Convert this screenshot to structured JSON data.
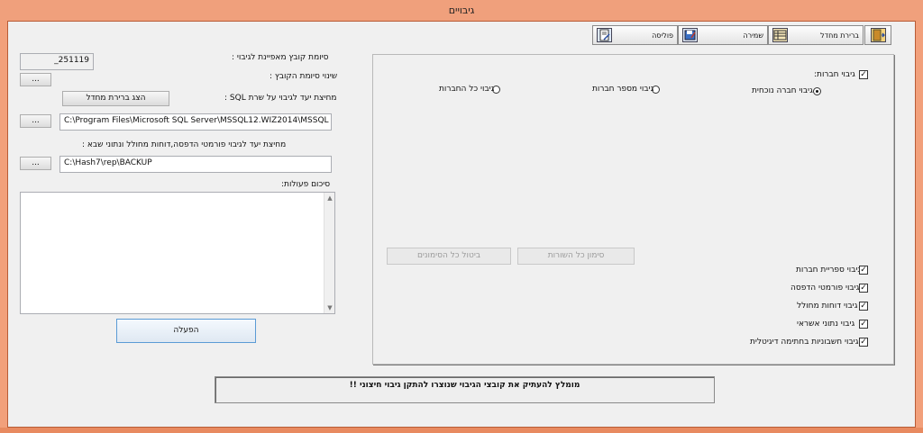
{
  "window": {
    "title": "גיבויים"
  },
  "toolbar": {
    "policy_label": "פוליסה",
    "save_label": "שמירה",
    "default_label": "ברירת מחדל"
  },
  "left": {
    "file_suffix_label": "סיומת קובץ מאפיינת לגיבוי :",
    "file_suffix_value": "_251119",
    "change_suffix_label": "שינוי סיומת הקובץ :",
    "browse_label": "...",
    "sql_path_label": "מחיצת יעד לגיבוי על שרת SQL :",
    "show_default_button": "הצג ברירת מחדל",
    "sql_path_value": "C:\\Program Files\\Microsoft SQL Server\\MSSQL12.WIZ2014\\MSSQL",
    "forms_path_label": "מחיצת יעד לגיבוי פורמטי הדפסה,דוחות מחולל ונתוני שבא :",
    "forms_path_value": "C:\\Hash7\\rep\\BACKUP",
    "summary_label": "סיכום פעולות:",
    "summary_text": "",
    "run_button": "הפעלה"
  },
  "right": {
    "companies_backup": {
      "label": "גיבוי חברות:",
      "checked": true
    },
    "radios": [
      {
        "label": "גיבוי חברה נוכחית",
        "selected": true
      },
      {
        "label": "גיבוי מספר חברות",
        "selected": false
      },
      {
        "label": "גיבוי כל החברות",
        "selected": false
      }
    ],
    "mark_all_button": "סימון כל השורות",
    "clear_all_button": "ביטול כל הסימונים",
    "options": [
      {
        "label": "גיבוי ספריית חברות",
        "checked": true
      },
      {
        "label": "גיבוי פורמטי הדפסה",
        "checked": true
      },
      {
        "label": "גיבוי דוחות מחולל",
        "checked": true
      },
      {
        "label": "גיבוי נתוני אשראי",
        "checked": true
      },
      {
        "label": "גיבוי חשבוניות בחתימה דיגיטלית",
        "checked": true
      }
    ]
  },
  "footer": {
    "message": "מומלץ להעתיק את קובצי הגיבוי שנוצרו להתקן גיבוי חיצוני !!"
  },
  "colors": {
    "titlebar": "#f0a07c",
    "client": "#f0f0f0",
    "accent_button_border": "#5b9bd5"
  }
}
